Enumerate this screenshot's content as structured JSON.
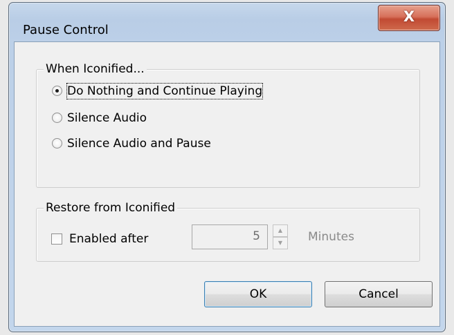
{
  "window": {
    "title": "Pause Control",
    "close_label": "X"
  },
  "when_iconified": {
    "legend": "When Iconified...",
    "options": [
      {
        "label": "Do Nothing and Continue Playing",
        "selected": true
      },
      {
        "label": "Silence Audio",
        "selected": false
      },
      {
        "label": "Silence Audio and Pause",
        "selected": false
      }
    ]
  },
  "restore": {
    "legend": "Restore from Iconified",
    "enabled_label": "Enabled after",
    "enabled_checked": false,
    "minutes_value": "5",
    "minutes_label": "Minutes"
  },
  "buttons": {
    "ok": "OK",
    "cancel": "Cancel"
  },
  "icons": {
    "close": "close-icon",
    "spin_up": "up-arrow-icon",
    "spin_down": "down-arrow-icon"
  }
}
